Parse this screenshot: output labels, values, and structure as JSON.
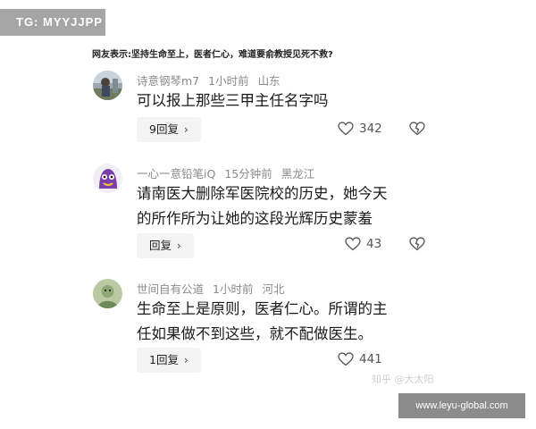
{
  "badge": {
    "label": "TG: MYYJJPP"
  },
  "headline": "网友表示:坚持生命至上，医者仁心，难道要俞教授见死不救?",
  "comments": [
    {
      "username": "诗意钢琴m7",
      "time": "1小时前",
      "location": "山东",
      "text": "可以报上那些三甲主任名字吗",
      "reply_label": "9回复",
      "likes": "342"
    },
    {
      "username": "一心一意铅笔iQ",
      "time": "15分钟前",
      "location": "黑龙江",
      "text_lines": [
        "请南医大删除军医院校的历史，她今天",
        "的所作所为让她的这段光辉历史蒙羞"
      ],
      "reply_label": "回复",
      "likes": "43"
    },
    {
      "username": "世间自有公道",
      "time": "1小时前",
      "location": "河北",
      "text_lines": [
        "生命至上是原则，医者仁心。所谓的主",
        "任如果做不到这些，就不配做医生。"
      ],
      "reply_label": "1回复",
      "likes": "441"
    }
  ],
  "watermark": "知乎 @大太阳",
  "site_badge": "www.leyu-global.com",
  "icons": {
    "like": "heart-icon",
    "dislike": "broken-heart-icon",
    "reply_chevron": "chevron-right-icon"
  }
}
